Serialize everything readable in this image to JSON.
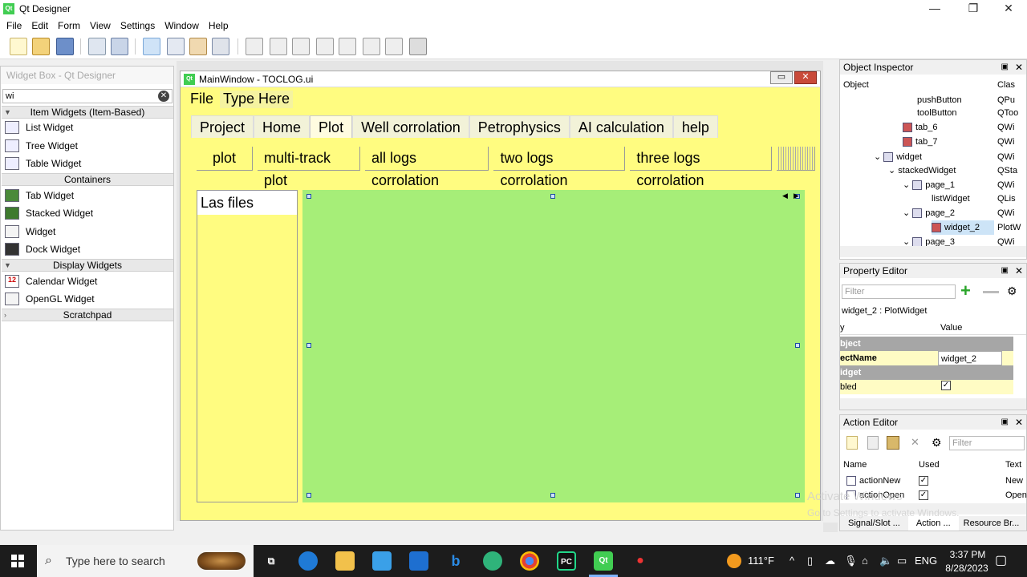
{
  "window": {
    "title": "Qt Designer",
    "minimize": "—",
    "maximize": "❐",
    "close": "✕"
  },
  "menubar": [
    "File",
    "Edit",
    "Form",
    "View",
    "Settings",
    "Window",
    "Help"
  ],
  "widget_box": {
    "title": "Widget Box - Qt Designer",
    "filter_value": "wi",
    "categories": {
      "item_based": "Item Widgets (Item-Based)",
      "containers": "Containers",
      "display": "Display Widgets",
      "scratchpad": "Scratchpad"
    },
    "items_item_based": [
      "List Widget",
      "Tree Widget",
      "Table Widget"
    ],
    "items_containers": [
      "Tab Widget",
      "Stacked Widget",
      "Widget",
      "Dock Widget"
    ],
    "items_display": [
      "Calendar Widget",
      "OpenGL Widget"
    ]
  },
  "form": {
    "title": "MainWindow - TOCLOG.ui",
    "menu_file": "File",
    "menu_type_here": "Type Here",
    "tabs": [
      "Project",
      "Home",
      "Plot",
      "Well corrolation",
      "Petrophysics",
      "AI calculation",
      "help"
    ],
    "active_tab": "Plot",
    "subtabs": [
      "plot",
      "multi-track plot",
      "all logs corrolation",
      "two logs corrolation",
      "three logs corrolation"
    ],
    "las_files_label": "Las files"
  },
  "object_inspector": {
    "title": "Object Inspector",
    "col_object": "Object",
    "col_class": "Clas",
    "rows": [
      {
        "name": "pushButton",
        "cls": "QPu"
      },
      {
        "name": "toolButton",
        "cls": "QToo"
      },
      {
        "name": "tab_6",
        "cls": "QWi"
      },
      {
        "name": "tab_7",
        "cls": "QWi"
      },
      {
        "name": "widget",
        "cls": "QWi"
      },
      {
        "name": "stackedWidget",
        "cls": "QSta"
      },
      {
        "name": "page_1",
        "cls": "QWi"
      },
      {
        "name": "listWidget",
        "cls": "QLis"
      },
      {
        "name": "page_2",
        "cls": "QWi"
      },
      {
        "name": "widget_2",
        "cls": "PlotW"
      },
      {
        "name": "page_3",
        "cls": "QWi"
      }
    ]
  },
  "property_editor": {
    "title": "Property Editor",
    "filter_placeholder": "Filter",
    "current": "widget_2 : PlotWidget",
    "col_property": "y",
    "col_value": "Value",
    "section_object": "bject",
    "prop_objectname": "ectName",
    "prop_objectname_value": "widget_2",
    "section_widget": "idget",
    "prop_enabled": "bled"
  },
  "action_editor": {
    "title": "Action Editor",
    "filter_placeholder": "Filter",
    "col_name": "Name",
    "col_used": "Used",
    "col_text": "Text",
    "rows": [
      {
        "name": "actionNew",
        "text": "New"
      },
      {
        "name": "actionOpen",
        "text": "Open"
      }
    ],
    "bottom_tabs": [
      "Signal/Slot ...",
      "Action ...",
      "Resource Br..."
    ]
  },
  "watermark": {
    "line1": "Activate Windows",
    "line2": "Go to Settings to activate Windows."
  },
  "taskbar": {
    "search_placeholder": "Type here to search",
    "temperature": "111°F",
    "language": "ENG",
    "time": "3:37 PM",
    "date": "8/28/2023"
  }
}
